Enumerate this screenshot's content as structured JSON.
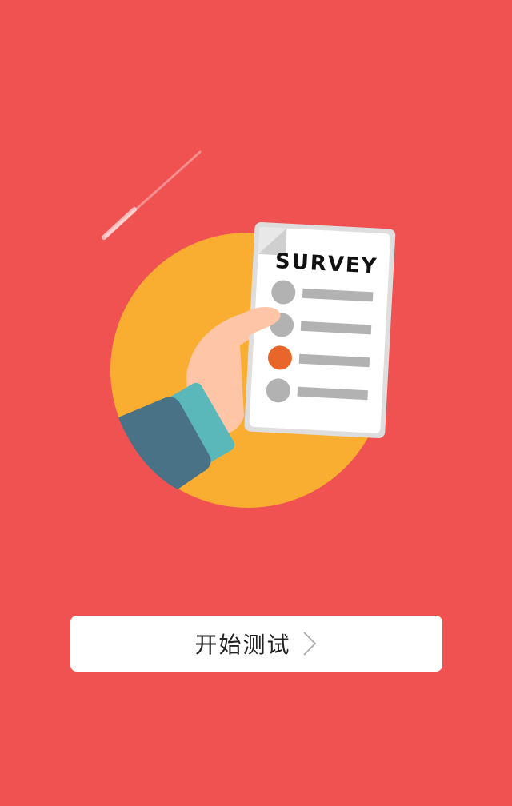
{
  "colors": {
    "background": "#f05252",
    "circle": "#f9ae31",
    "sleeve": "#4a7287",
    "cuff": "#5ab8bb",
    "hand": "#fec6a6",
    "paper": "#ffffff",
    "paper_edge": "#dedede",
    "bullet_gray": "#b2b2b2",
    "bullet_selected": "#e9662b",
    "button_bg": "#ffffff",
    "button_text": "#222222",
    "chevron": "#b0b0b0"
  },
  "illustration": {
    "survey_title": "SURVEY",
    "options_count_shown": 4,
    "selected_option_index": 2
  },
  "start_button": {
    "label": "开始测试",
    "icon": "chevron-right-icon"
  }
}
